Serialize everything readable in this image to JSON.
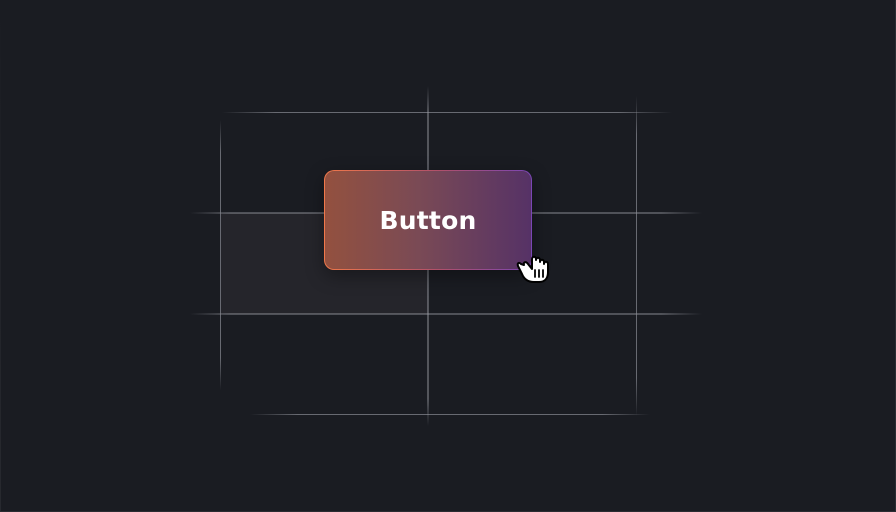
{
  "canvas": {
    "background": "#1a1c22",
    "grid_color": "#8a8c94",
    "highlight_cell_color": "#25252b"
  },
  "button": {
    "label": "Button",
    "gradient_start": "#93513f",
    "gradient_end": "#563266",
    "border_start": "#f0784a",
    "border_end": "#7a46b4",
    "text_color": "#ffffff"
  },
  "cursor": {
    "icon": "grab-hand-cursor-icon"
  }
}
